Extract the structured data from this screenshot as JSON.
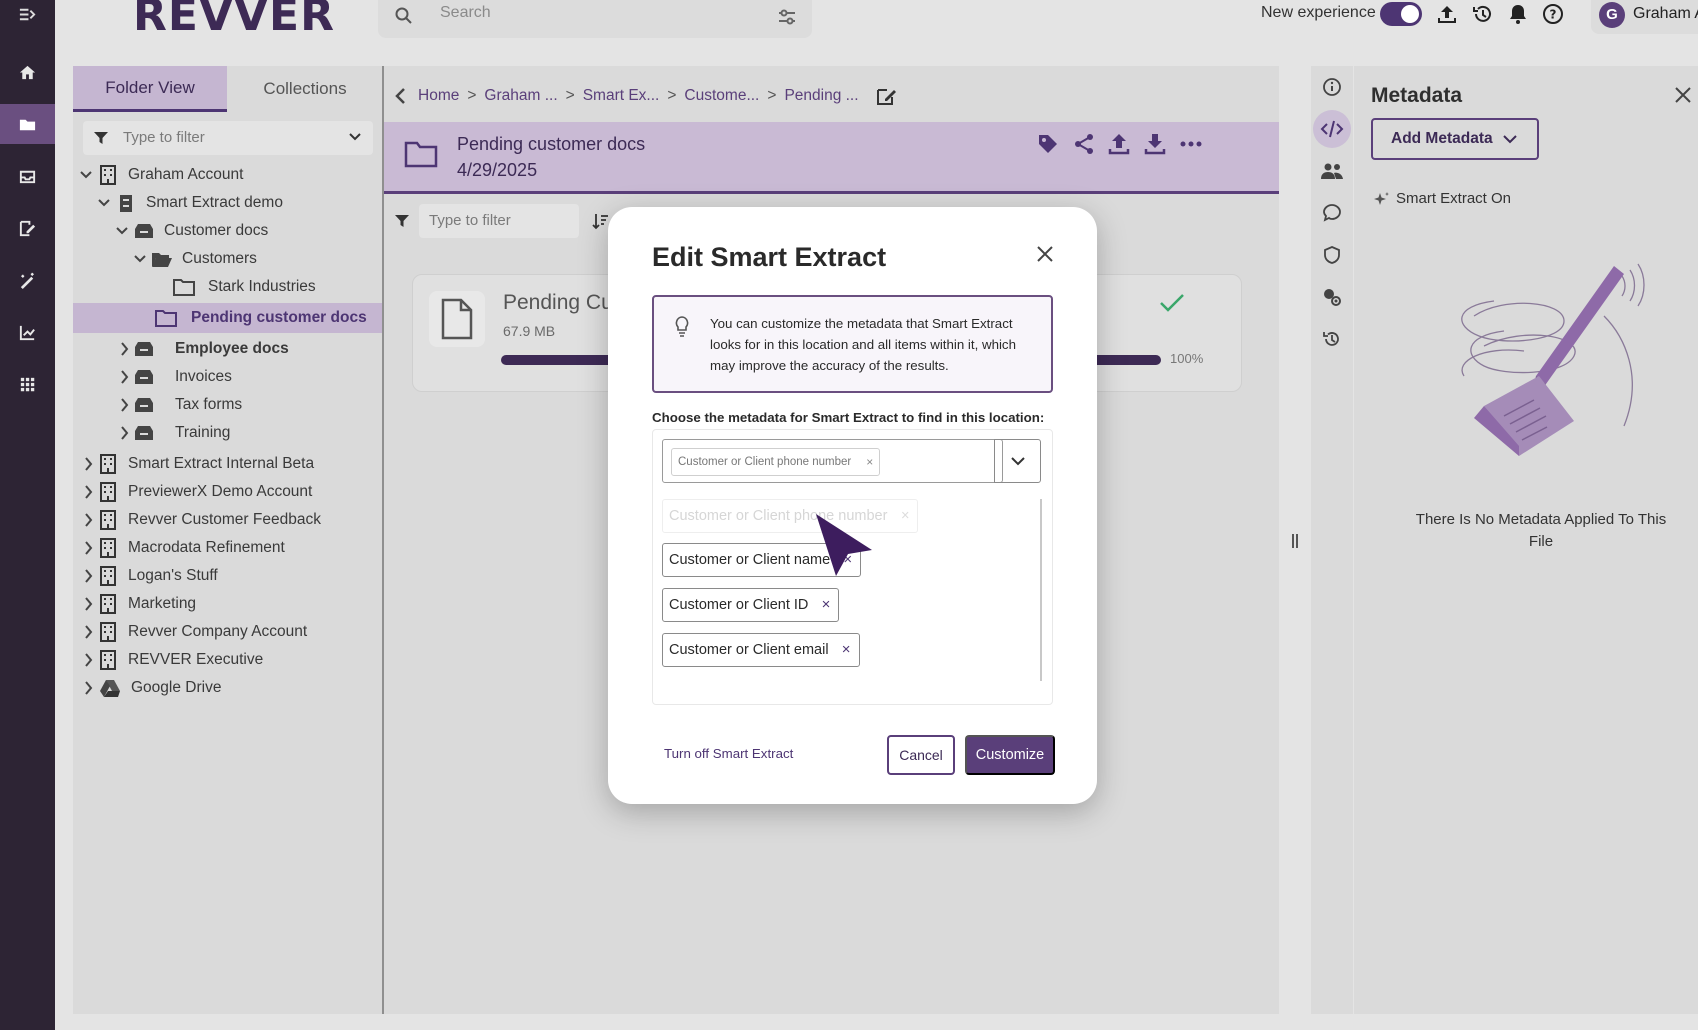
{
  "app": {
    "logo_text": "REVVER",
    "colors": {
      "brand": "#4d3573",
      "rail": "#2d2434",
      "accent_light": "#c5b6d1"
    }
  },
  "topbar": {
    "search_placeholder": "Search",
    "new_experience_label": "New experience",
    "new_experience_on": true,
    "account_initial": "G",
    "account_name": "Graham Account",
    "icons": [
      "upload-icon",
      "history-icon",
      "bell-icon",
      "help-icon"
    ]
  },
  "rail": {
    "items": [
      "menu-expand-icon",
      "home-icon",
      "folder-icon",
      "inbox-icon",
      "edit-icon",
      "magic-icon",
      "chart-icon",
      "apps-icon"
    ],
    "active": "folder-icon"
  },
  "folder_panel": {
    "tabs": [
      "Folder View",
      "Collections"
    ],
    "active_tab": "Folder View",
    "filter_placeholder": "Type to filter",
    "tree": [
      {
        "label": "Graham Account",
        "level": 0,
        "expanded": true,
        "icon": "building-icon"
      },
      {
        "label": "Smart Extract demo",
        "level": 1,
        "expanded": true,
        "icon": "cabinet-icon"
      },
      {
        "label": "Customer docs",
        "level": 2,
        "expanded": true,
        "icon": "drawer-icon"
      },
      {
        "label": "Customers",
        "level": 3,
        "expanded": true,
        "icon": "open-folder-icon"
      },
      {
        "label": "Stark Industries",
        "level": 4,
        "icon": "folder-icon"
      },
      {
        "label": "Pending customer docs",
        "level": 4,
        "icon": "folder-icon",
        "selected": true
      },
      {
        "label": "Employee docs",
        "level": 2,
        "icon": "drawer-icon"
      },
      {
        "label": "Invoices",
        "level": 2,
        "icon": "drawer-icon"
      },
      {
        "label": "Tax forms",
        "level": 2,
        "icon": "drawer-icon"
      },
      {
        "label": "Training",
        "level": 2,
        "icon": "drawer-icon"
      },
      {
        "label": "Smart Extract Internal Beta",
        "level": 0,
        "icon": "building-icon"
      },
      {
        "label": "PreviewerX Demo Account",
        "level": 0,
        "icon": "building-icon"
      },
      {
        "label": "Revver Customer Feedback",
        "level": 0,
        "icon": "building-icon"
      },
      {
        "label": "Macrodata Refinement",
        "level": 0,
        "icon": "building-icon"
      },
      {
        "label": "Logan's Stuff",
        "level": 0,
        "icon": "building-icon"
      },
      {
        "label": "Marketing",
        "level": 0,
        "icon": "building-icon"
      },
      {
        "label": "Revver Company Account",
        "level": 0,
        "icon": "building-icon"
      },
      {
        "label": "REVVER Executive",
        "level": 0,
        "icon": "building-icon"
      },
      {
        "label": "Google Drive",
        "level": 0,
        "icon": "google-drive-icon"
      }
    ]
  },
  "content": {
    "breadcrumbs": [
      "Home",
      "Graham ...",
      "Smart Ex...",
      "Custome...",
      "Pending ..."
    ],
    "folder_title": "Pending customer docs",
    "folder_date": "4/29/2025",
    "filter_placeholder": "Type to filter",
    "upload": {
      "name": "Pending Cu",
      "size": "67.9 MB",
      "progress_percent": 100,
      "progress_label": "100%"
    }
  },
  "metadata_panel": {
    "title": "Metadata",
    "add_button": "Add Metadata",
    "smart_extract_status": "Smart Extract On",
    "empty_message": "There Is No Metadata Applied To This File"
  },
  "modal": {
    "title": "Edit Smart Extract",
    "info_text": "You can customize the metadata that Smart Extract looks for in this location and all items within it, which may improve the accuracy of the results.",
    "choose_label": "Choose the metadata for Smart Extract to find in this location:",
    "selected_chip": "Customer or Client phone number",
    "dragging_chip": "Customer or Client phone number",
    "chips": [
      "Customer or Client name",
      "Customer or Client ID",
      "Customer or Client email"
    ],
    "remove_glyph": "×",
    "turn_off_link": "Turn off Smart Extract",
    "cancel_button": "Cancel",
    "customize_button": "Customize"
  }
}
